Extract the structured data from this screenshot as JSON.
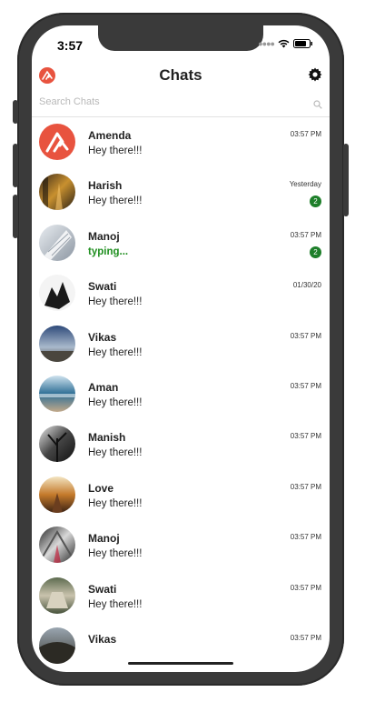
{
  "status_bar": {
    "time": "3:57"
  },
  "header": {
    "title": "Chats"
  },
  "search": {
    "placeholder": "Search Chats"
  },
  "colors": {
    "badge": "#1e7f2a",
    "typing": "#1f8f1f",
    "logo": "#e8533f"
  },
  "chats": [
    {
      "name": "Amenda",
      "message": "Hey there!!!",
      "time": "03:57 PM",
      "badge": "",
      "avatar": "logo-avatar"
    },
    {
      "name": "Harish",
      "message": "Hey there!!!",
      "time": "Yesterday",
      "badge": "2",
      "avatar": "sunset-path-photo"
    },
    {
      "name": "Manoj",
      "message": "typing...",
      "time": "03:57 PM",
      "badge": "2",
      "avatar": "building-photo"
    },
    {
      "name": "Swati",
      "message": "Hey there!!!",
      "time": "01/30/20",
      "badge": "",
      "avatar": "hands-photo"
    },
    {
      "name": "Vikas",
      "message": "Hey there!!!",
      "time": "03:57 PM",
      "badge": "",
      "avatar": "sky-photo"
    },
    {
      "name": "Aman",
      "message": "Hey there!!!",
      "time": "03:57 PM",
      "badge": "",
      "avatar": "sea-photo"
    },
    {
      "name": "Manish",
      "message": "Hey there!!!",
      "time": "03:57 PM",
      "badge": "",
      "avatar": "tree-photo"
    },
    {
      "name": "Love",
      "message": "Hey there!!!",
      "time": "03:57 PM",
      "badge": "",
      "avatar": "bridge-photo"
    },
    {
      "name": "Manoj",
      "message": "Hey there!!!",
      "time": "03:57 PM",
      "badge": "",
      "avatar": "walkway-photo"
    },
    {
      "name": "Swati",
      "message": "Hey there!!!",
      "time": "03:57 PM",
      "badge": "",
      "avatar": "steps-photo"
    },
    {
      "name": "Vikas",
      "message": "",
      "time": "03:57 PM",
      "badge": "",
      "avatar": "landscape-photo"
    }
  ]
}
